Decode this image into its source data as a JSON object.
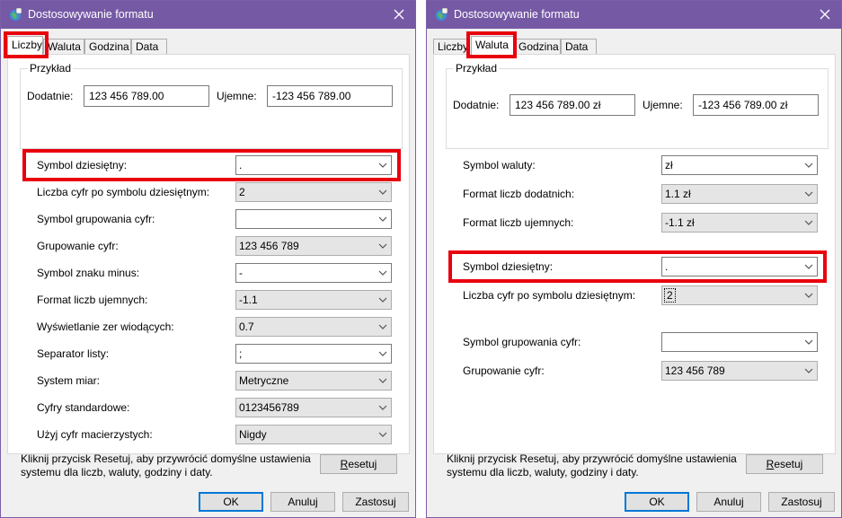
{
  "app_title": "Dostosowywanie formatu",
  "tabs": [
    "Liczby",
    "Waluta",
    "Godzina",
    "Data"
  ],
  "left": {
    "active_tab": "Liczby",
    "example": {
      "group_title": "Przykład",
      "positive_label": "Dodatnie:",
      "positive_value": "123 456 789.00",
      "negative_label": "Ujemne:",
      "negative_value": "-123 456 789.00"
    },
    "settings": [
      {
        "label": "Symbol dziesiętny:",
        "value": ".",
        "kind": "edit",
        "highlight": true
      },
      {
        "label": "Liczba cyfr po symbolu dziesiętnym:",
        "value": "2",
        "kind": "list"
      },
      {
        "label": "Symbol grupowania cyfr:",
        "value": "",
        "kind": "edit"
      },
      {
        "label": "Grupowanie cyfr:",
        "value": "123 456 789",
        "kind": "list"
      },
      {
        "label": "Symbol znaku minus:",
        "value": "-",
        "kind": "edit"
      },
      {
        "label": "Format liczb ujemnych:",
        "value": "-1.1",
        "kind": "list"
      },
      {
        "label": "Wyświetlanie zer wiodących:",
        "value": "0.7",
        "kind": "list"
      },
      {
        "label": "Separator listy:",
        "value": ";",
        "kind": "edit"
      },
      {
        "label": "System miar:",
        "value": "Metryczne",
        "kind": "list"
      },
      {
        "label": "Cyfry standardowe:",
        "value": "0123456789",
        "kind": "list"
      },
      {
        "label": "Użyj cyfr macierzystych:",
        "value": "Nigdy",
        "kind": "list"
      }
    ],
    "reset_text": "Kliknij przycisk Resetuj, aby przywrócić domyślne ustawienia systemu dla liczb, waluty, godziny i daty.",
    "reset_button": "Resetuj"
  },
  "right": {
    "active_tab": "Waluta",
    "example": {
      "group_title": "Przykład",
      "positive_label": "Dodatnie:",
      "positive_value": "123 456 789.00 zł",
      "negative_label": "Ujemne:",
      "negative_value": "-123 456 789.00 zł"
    },
    "settings": [
      {
        "label": "Symbol waluty:",
        "value": "zł",
        "kind": "edit"
      },
      {
        "label": "Format liczb dodatnich:",
        "value": "1.1 zł",
        "kind": "list"
      },
      {
        "label": "Format liczb ujemnych:",
        "value": "-1.1 zł",
        "kind": "list"
      },
      {
        "label": "Symbol dziesiętny:",
        "value": ".",
        "kind": "edit",
        "highlight": true
      },
      {
        "label": "Liczba cyfr po symbolu dziesiętnym:",
        "value": "2",
        "kind": "list",
        "focused": true
      },
      {
        "label": "Symbol grupowania cyfr:",
        "value": "",
        "kind": "edit"
      },
      {
        "label": "Grupowanie cyfr:",
        "value": "123 456 789",
        "kind": "list"
      }
    ],
    "reset_text": "Kliknij przycisk Resetuj, aby przywrócić domyślne ustawienia systemu dla liczb, waluty, godziny i daty.",
    "reset_button": "Resetuj"
  },
  "buttons": {
    "ok": "OK",
    "cancel": "Anuluj",
    "apply": "Zastosuj"
  },
  "colors": {
    "titlebar": "#7659a5",
    "highlight": "#e8000d",
    "default_button_border": "#0078d7"
  },
  "icons": {
    "app": "globe-icon",
    "close": "close-icon",
    "dropdown": "chevron-down-icon"
  }
}
